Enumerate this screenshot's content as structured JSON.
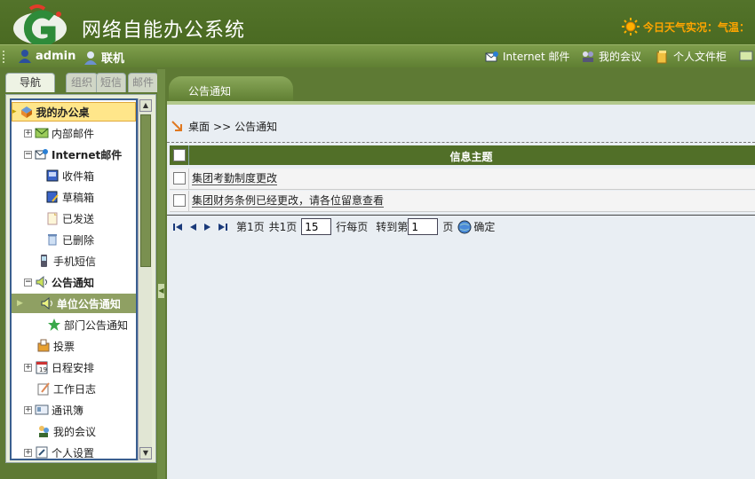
{
  "header": {
    "title": "网络自能办公系统",
    "weather": "今日天气实况：气温：",
    "brand_color": "#4a6a22"
  },
  "userbar": {
    "user": "admin",
    "status": "联机",
    "links": [
      "Internet 邮件",
      "我的会议",
      "个人文件柜"
    ]
  },
  "leftpanel": {
    "tabs": [
      "导航",
      "组织",
      "短信",
      "邮件"
    ],
    "tree": [
      {
        "label": "我的办公桌",
        "icon": "desk-icon"
      },
      {
        "label": "内部邮件",
        "icon": "mail-icon"
      },
      {
        "label": "Internet邮件",
        "icon": "internet-mail-icon"
      },
      {
        "label": "收件箱",
        "icon": "inbox-icon"
      },
      {
        "label": "草稿箱",
        "icon": "drafts-icon"
      },
      {
        "label": "已发送",
        "icon": "sent-icon"
      },
      {
        "label": "已删除",
        "icon": "trash-icon"
      },
      {
        "label": "手机短信",
        "icon": "phone-icon"
      },
      {
        "label": "公告通知",
        "icon": "speaker-icon"
      },
      {
        "label": "单位公告通知",
        "icon": "speaker-icon"
      },
      {
        "label": "部门公告通知",
        "icon": "star-icon"
      },
      {
        "label": "投票",
        "icon": "vote-icon"
      },
      {
        "label": "日程安排",
        "icon": "calendar-icon"
      },
      {
        "label": "工作日志",
        "icon": "journal-icon"
      },
      {
        "label": "通讯簿",
        "icon": "addressbook-icon"
      },
      {
        "label": "我的会议",
        "icon": "meeting-icon"
      },
      {
        "label": "个人设置",
        "icon": "settings-icon"
      }
    ]
  },
  "content": {
    "tab_label": "公告通知",
    "breadcrumb": {
      "home": "桌面",
      "sep": ">>",
      "current": "公告通知"
    },
    "grid": {
      "column": "信息主题",
      "rows": [
        "集团考勤制度更改",
        "集团财务条例已经更改，请各位留意查看"
      ]
    },
    "pager": {
      "page_label": "第1页",
      "total_label": "共1页",
      "per_page": "15",
      "per_page_label": "行每页",
      "goto_label": "转到第",
      "goto_value": "1",
      "page_suffix": "页",
      "confirm": "确定"
    }
  }
}
